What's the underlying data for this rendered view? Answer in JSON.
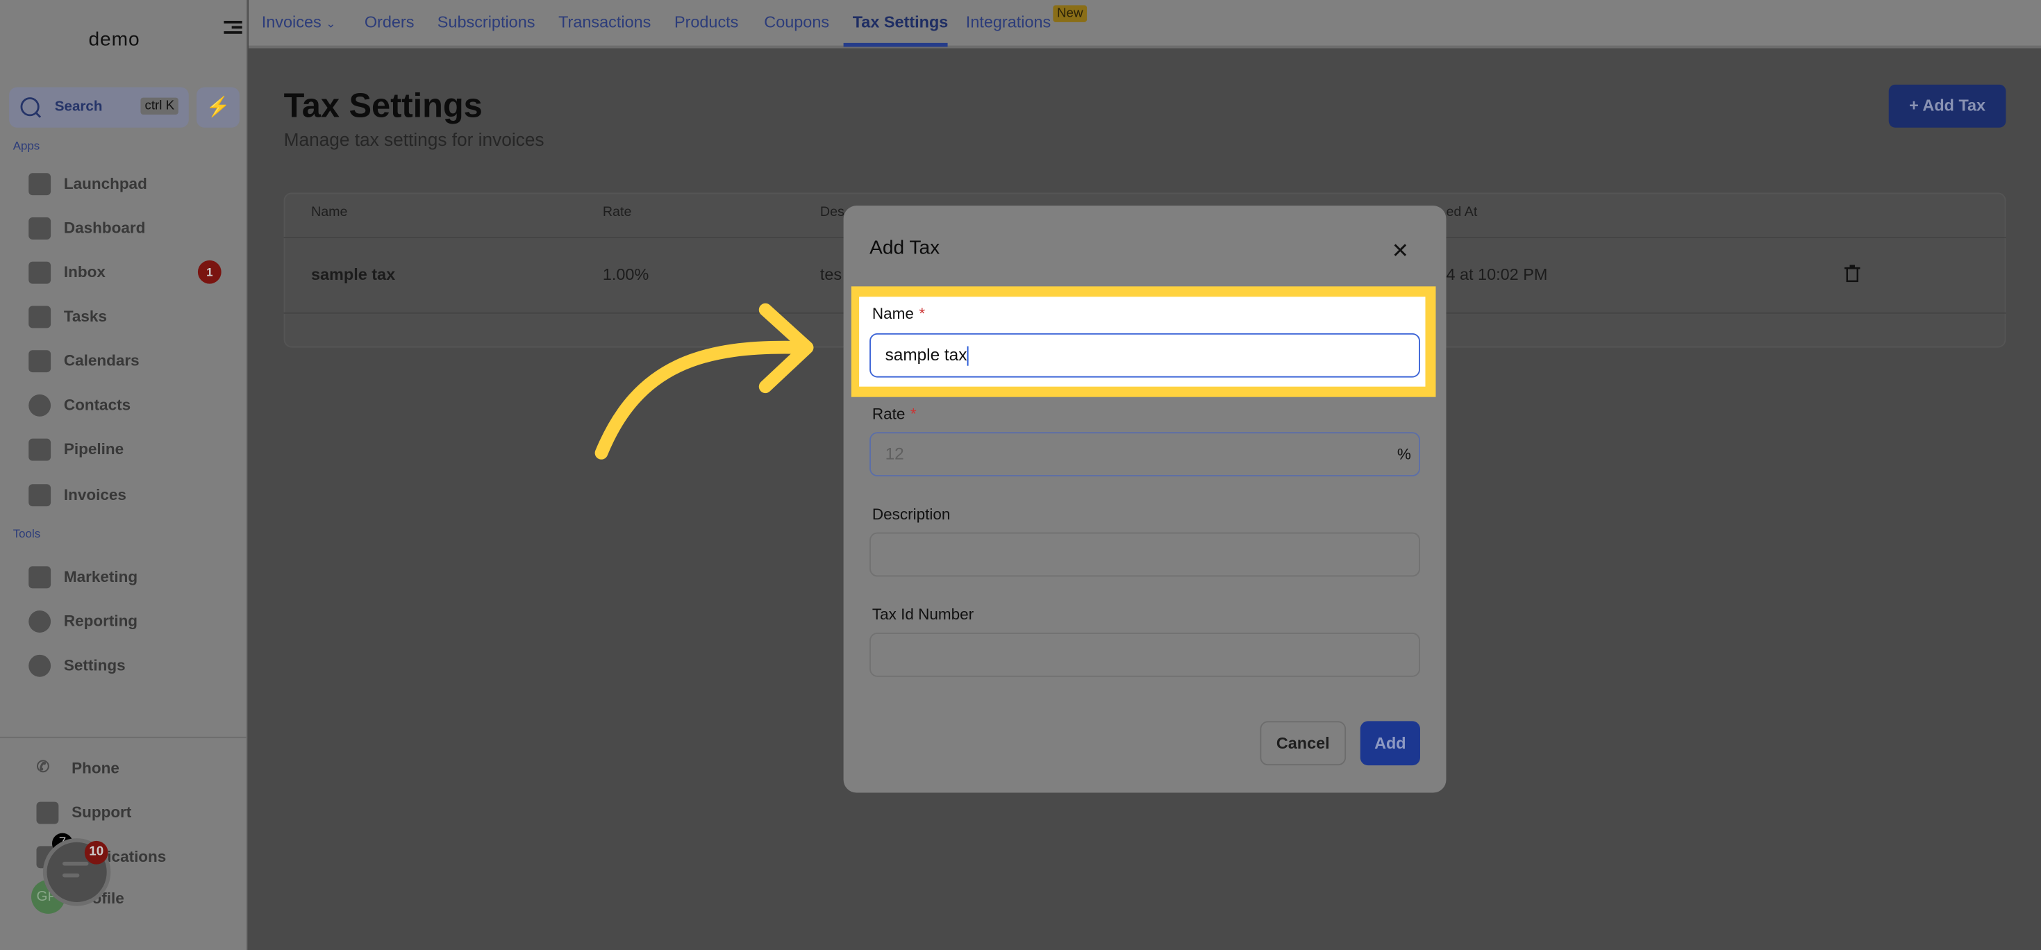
{
  "brand": {
    "logo": "demo"
  },
  "search": {
    "label": "Search",
    "shortcut": "ctrl K"
  },
  "sidebar": {
    "apps_label": "Apps",
    "apps": [
      {
        "label": "Launchpad"
      },
      {
        "label": "Dashboard"
      },
      {
        "label": "Inbox",
        "badge": "1"
      },
      {
        "label": "Tasks"
      },
      {
        "label": "Calendars"
      },
      {
        "label": "Contacts"
      },
      {
        "label": "Pipeline"
      },
      {
        "label": "Invoices"
      }
    ],
    "tools_label": "Tools",
    "tools": [
      {
        "label": "Marketing"
      },
      {
        "label": "Reporting"
      },
      {
        "label": "Settings"
      }
    ],
    "bottom": [
      {
        "label": "Phone"
      },
      {
        "label": "Support"
      },
      {
        "label": "Notifications",
        "badge": "7"
      },
      {
        "label": "Profile",
        "avatar": "GP"
      }
    ],
    "chat_badge": "10"
  },
  "topnav": {
    "tabs": [
      "Invoices",
      "Orders",
      "Subscriptions",
      "Transactions",
      "Products",
      "Coupons",
      "Tax Settings",
      "Integrations"
    ],
    "active": "Tax Settings",
    "new_badge": "New"
  },
  "page": {
    "title": "Tax Settings",
    "subtitle": "Manage tax settings for invoices",
    "add_button": "+ Add Tax"
  },
  "table": {
    "headers": [
      "Name",
      "Rate",
      "Des",
      "ed At"
    ],
    "rows": [
      {
        "name": "sample tax",
        "rate": "1.00%",
        "description": "tes",
        "created": "4 at 10:02 PM"
      }
    ]
  },
  "modal": {
    "title": "Add Tax",
    "fields": [
      {
        "label": "Name",
        "required": true,
        "value": "sample tax"
      },
      {
        "label": "Rate",
        "required": true,
        "placeholder": "12",
        "suffix": "%"
      },
      {
        "label": "Description",
        "value": ""
      },
      {
        "label": "Tax Id Number",
        "value": ""
      }
    ],
    "cancel": "Cancel",
    "add": "Add"
  },
  "colors": {
    "highlight": "#ffd23f",
    "accent": "#2456d6"
  }
}
